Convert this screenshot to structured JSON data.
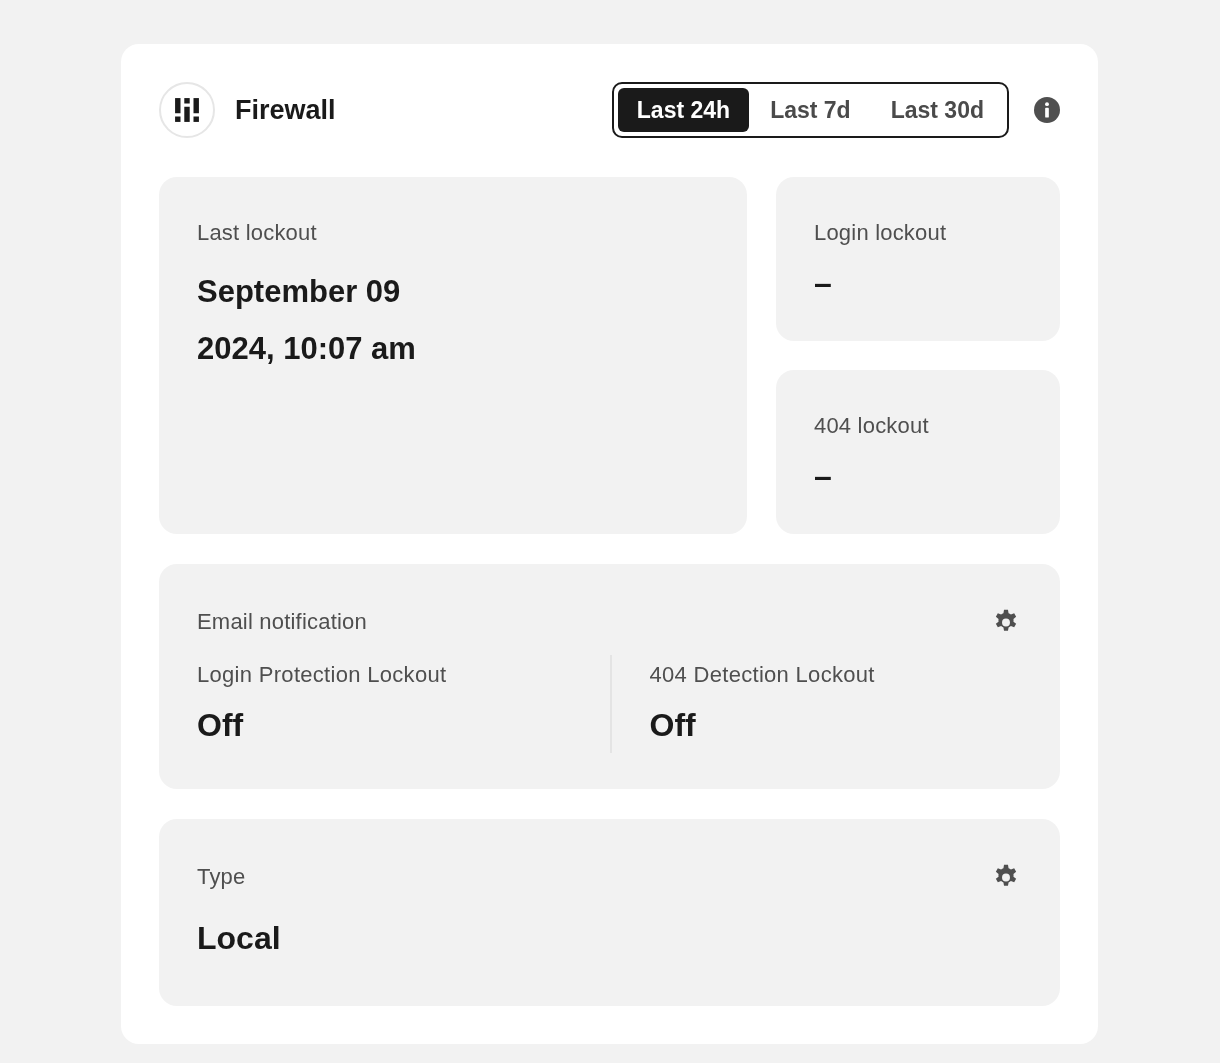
{
  "header": {
    "title": "Firewall"
  },
  "period_tabs": [
    {
      "label": "Last 24h",
      "selected": true
    },
    {
      "label": "Last 7d",
      "selected": false
    },
    {
      "label": "Last 30d",
      "selected": false
    }
  ],
  "last_lockout": {
    "label": "Last lockout",
    "value": "September 09\n2024, 10:07 am"
  },
  "lockout_counts": [
    {
      "label": "Login lockout",
      "value": "–"
    },
    {
      "label": "404 lockout",
      "value": "–"
    }
  ],
  "email_notification": {
    "label": "Email notification",
    "settings": [
      {
        "label": "Login Protection Lockout",
        "value": "Off"
      },
      {
        "label": "404 Detection Lockout",
        "value": "Off"
      }
    ]
  },
  "type": {
    "label": "Type",
    "value": "Local"
  }
}
